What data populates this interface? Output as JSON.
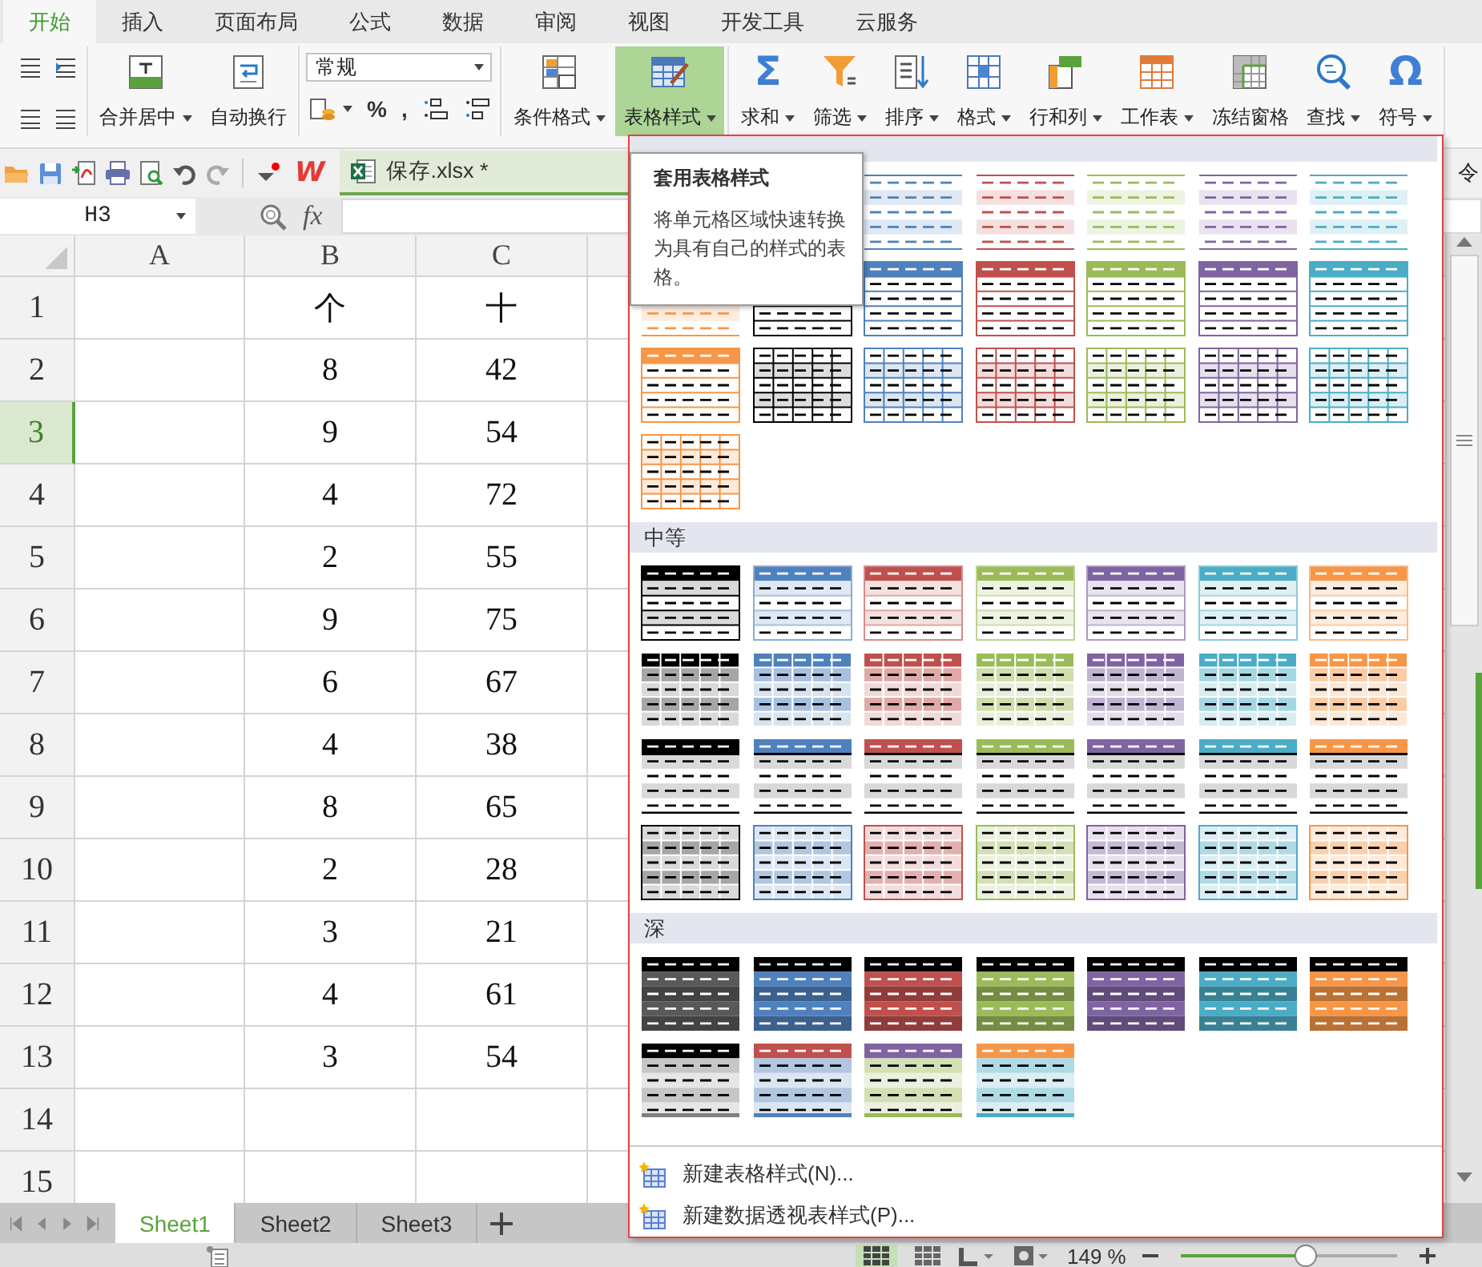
{
  "tabs": [
    {
      "label": "开始",
      "selected": true
    },
    {
      "label": "插入",
      "selected": false
    },
    {
      "label": "页面布局",
      "selected": false
    },
    {
      "label": "公式",
      "selected": false
    },
    {
      "label": "数据",
      "selected": false
    },
    {
      "label": "审阅",
      "selected": false
    },
    {
      "label": "视图",
      "selected": false
    },
    {
      "label": "开发工具",
      "selected": false
    },
    {
      "label": "云服务",
      "selected": false
    }
  ],
  "ribbon": {
    "groups": [
      {
        "kind": "buttons",
        "buttons": [
          {
            "kind": "merge",
            "label": "合并居中",
            "dropdown": true,
            "pressed": false
          },
          {
            "kind": "wrap",
            "label": "自动换行",
            "dropdown": false,
            "pressed": false
          }
        ]
      },
      {
        "kind": "number",
        "format": "常规",
        "small_buttons": [
          {
            "kind": "currency"
          },
          {
            "kind": "glyph",
            "glyph": "%"
          },
          {
            "kind": "glyph",
            "glyph": ","
          },
          {
            "kind": "increase-decimal"
          },
          {
            "kind": "decrease-decimal"
          }
        ]
      },
      {
        "kind": "buttons",
        "buttons": [
          {
            "kind": "conditional",
            "label": "条件格式",
            "dropdown": true,
            "pressed": false
          },
          {
            "kind": "table-style",
            "label": "表格样式",
            "dropdown": true,
            "pressed": true
          }
        ]
      },
      {
        "kind": "buttons",
        "buttons": [
          {
            "kind": "sum",
            "glyph": "Σ",
            "label": "求和",
            "dropdown": true,
            "pressed": false
          },
          {
            "kind": "filter",
            "label": "筛选",
            "dropdown": true,
            "pressed": false
          },
          {
            "kind": "sort",
            "label": "排序",
            "dropdown": true,
            "pressed": false
          },
          {
            "kind": "format",
            "label": "格式",
            "dropdown": true,
            "pressed": false
          },
          {
            "kind": "rowcol",
            "label": "行和列",
            "dropdown": true,
            "pressed": false
          },
          {
            "kind": "worksheet",
            "label": "工作表",
            "dropdown": true,
            "pressed": false
          },
          {
            "kind": "freeze",
            "label": "冻结窗格",
            "dropdown": false,
            "pressed": false
          },
          {
            "kind": "find",
            "label": "查找",
            "dropdown": true,
            "pressed": false
          },
          {
            "kind": "symbol",
            "glyph": "Ω",
            "label": "符号",
            "dropdown": true,
            "pressed": false
          }
        ]
      }
    ]
  },
  "quick_bar": {
    "logo": "W",
    "document_tab": "保存.xlsx *",
    "right_text": "令"
  },
  "formula_bar": {
    "name_box": "H3",
    "function_label": "fx"
  },
  "sheet": {
    "columns": [
      "A",
      "B",
      "C"
    ],
    "rows": [
      {
        "header": "1",
        "b": "个",
        "c": "十",
        "selected": false
      },
      {
        "header": "2",
        "b": "8",
        "c": "42",
        "selected": false
      },
      {
        "header": "3",
        "b": "9",
        "c": "54",
        "selected": true
      },
      {
        "header": "4",
        "b": "4",
        "c": "72",
        "selected": false
      },
      {
        "header": "5",
        "b": "2",
        "c": "55",
        "selected": false
      },
      {
        "header": "6",
        "b": "9",
        "c": "75",
        "selected": false
      },
      {
        "header": "7",
        "b": "6",
        "c": "67",
        "selected": false
      },
      {
        "header": "8",
        "b": "4",
        "c": "38",
        "selected": false
      },
      {
        "header": "9",
        "b": "8",
        "c": "65",
        "selected": false
      },
      {
        "header": "10",
        "b": "2",
        "c": "28",
        "selected": false
      },
      {
        "header": "11",
        "b": "3",
        "c": "21",
        "selected": false
      },
      {
        "header": "12",
        "b": "4",
        "c": "61",
        "selected": false
      },
      {
        "header": "13",
        "b": "3",
        "c": "54",
        "selected": false
      },
      {
        "header": "14",
        "selected": false
      },
      {
        "header": "15",
        "selected": false
      }
    ]
  },
  "sheet_tabs": [
    {
      "label": "Sheet1",
      "selected": true
    },
    {
      "label": "Sheet2",
      "selected": false
    },
    {
      "label": "Sheet3",
      "selected": false
    }
  ],
  "status_bar": {
    "zoom": "149 %",
    "zoom_slider": {
      "level": 0.58
    }
  },
  "gallery": {
    "sections": [
      {
        "swatches": [
          {
            "kind": "band",
            "color": "#4f81bd"
          },
          {
            "kind": "band",
            "color": "#c0504d"
          },
          {
            "kind": "band",
            "color": "#9bbb59"
          },
          {
            "kind": "band",
            "color": "#8064a2"
          },
          {
            "kind": "band",
            "color": "#4bacc6"
          },
          {
            "kind": "band",
            "color": "#f79646"
          },
          {
            "kind": "outline",
            "color": "#000000"
          },
          {
            "kind": "outline",
            "color": "#4f81bd"
          },
          {
            "kind": "outline",
            "color": "#c0504d"
          },
          {
            "kind": "outline",
            "color": "#9bbb59"
          },
          {
            "kind": "outline",
            "color": "#8064a2"
          },
          {
            "kind": "outline",
            "color": "#4bacc6"
          },
          {
            "kind": "outline",
            "color": "#f79646"
          },
          {
            "kind": "grid",
            "color": "#000000"
          },
          {
            "kind": "grid",
            "color": "#4f81bd"
          },
          {
            "kind": "grid",
            "color": "#c0504d"
          },
          {
            "kind": "grid",
            "color": "#9bbb59"
          },
          {
            "kind": "grid",
            "color": "#8064a2"
          },
          {
            "kind": "grid",
            "color": "#4bacc6"
          },
          {
            "kind": "grid",
            "color": "#f79646"
          }
        ]
      },
      {
        "title": "中等",
        "swatches": [
          {
            "kind": "header-band",
            "color": "#000000"
          },
          {
            "kind": "header-band",
            "color": "#4f81bd"
          },
          {
            "kind": "header-band",
            "color": "#c0504d"
          },
          {
            "kind": "header-band",
            "color": "#9bbb59"
          },
          {
            "kind": "header-band",
            "color": "#8064a2"
          },
          {
            "kind": "header-band",
            "color": "#4bacc6"
          },
          {
            "kind": "header-band",
            "color": "#f79646"
          },
          {
            "kind": "header-cells",
            "color": "#000000"
          },
          {
            "kind": "header-cells",
            "color": "#4f81bd"
          },
          {
            "kind": "header-cells",
            "color": "#c0504d"
          },
          {
            "kind": "header-cells",
            "color": "#9bbb59"
          },
          {
            "kind": "header-cells",
            "color": "#8064a2"
          },
          {
            "kind": "header-cells",
            "color": "#4bacc6"
          },
          {
            "kind": "header-cells",
            "color": "#f79646"
          },
          {
            "kind": "header-rule",
            "color": "#000000"
          },
          {
            "kind": "header-rule",
            "color": "#4f81bd"
          },
          {
            "kind": "header-rule",
            "color": "#c0504d"
          },
          {
            "kind": "header-rule",
            "color": "#9bbb59"
          },
          {
            "kind": "header-rule",
            "color": "#8064a2"
          },
          {
            "kind": "header-rule",
            "color": "#4bacc6"
          },
          {
            "kind": "header-rule",
            "color": "#f79646"
          },
          {
            "kind": "tinted-grid",
            "color": "#000000"
          },
          {
            "kind": "tinted-grid",
            "color": "#4f81bd"
          },
          {
            "kind": "tinted-grid",
            "color": "#c0504d"
          },
          {
            "kind": "tinted-grid",
            "color": "#9bbb59"
          },
          {
            "kind": "tinted-grid",
            "color": "#8064a2"
          },
          {
            "kind": "tinted-grid",
            "color": "#4bacc6"
          },
          {
            "kind": "tinted-grid",
            "color": "#f79646"
          }
        ]
      },
      {
        "title": "深",
        "swatches": [
          {
            "kind": "dark",
            "color": "#595959"
          },
          {
            "kind": "dark",
            "color": "#4f81bd"
          },
          {
            "kind": "dark",
            "color": "#c0504d"
          },
          {
            "kind": "dark",
            "color": "#9bbb59"
          },
          {
            "kind": "dark",
            "color": "#8064a2"
          },
          {
            "kind": "dark",
            "color": "#4bacc6"
          },
          {
            "kind": "dark",
            "color": "#f79646"
          },
          {
            "kind": "dark-light",
            "color": "#808080",
            "header": {
              "color": "#000000"
            }
          },
          {
            "kind": "dark-light",
            "color": "#4f81bd",
            "header": {
              "color": "#c0504d"
            }
          },
          {
            "kind": "dark-light",
            "color": "#9bbb59",
            "header": {
              "color": "#8064a2"
            }
          },
          {
            "kind": "dark-light",
            "color": "#4bacc6",
            "header": {
              "color": "#f79646"
            }
          }
        ]
      }
    ],
    "menu": [
      "新建表格样式(N)...",
      "新建数据透视表样式(P)..."
    ]
  },
  "tooltip": {
    "title": "套用表格样式",
    "text": "将单元格区域快速转换为具有自己的样式的表格。"
  }
}
